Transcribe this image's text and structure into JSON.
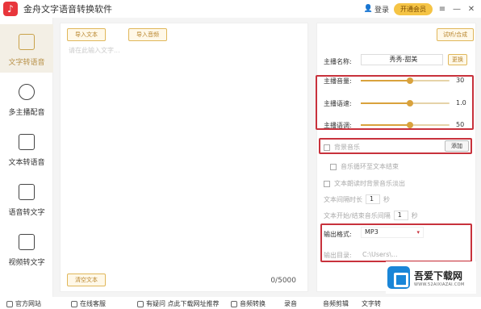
{
  "window": {
    "title": "金舟文字语音转换软件",
    "login": "登录",
    "vip": "开通会员"
  },
  "sidebar": {
    "items": [
      {
        "label": "文字转语音",
        "active": true
      },
      {
        "label": "多主播配音"
      },
      {
        "label": "文本转语音"
      },
      {
        "label": "语音转文字"
      },
      {
        "label": "视频转文字"
      }
    ]
  },
  "main": {
    "btn_import_text": "导入文本",
    "btn_import_audio": "导入音频",
    "placeholder": "请在此输入文字...",
    "btn_clear": "清空文本",
    "counter": "0/5000"
  },
  "right": {
    "btn_top": "试听/合成",
    "anchor_label": "主播名称:",
    "anchor_value": "秀秀-甜美",
    "anchor_btn": "更换",
    "volume_label": "主播音量:",
    "volume_value": "30",
    "speed_label": "主播语速:",
    "speed_value": "1.0",
    "pitch_label": "主播语调:",
    "pitch_value": "50",
    "bgm_label": "背景音乐",
    "bgm_btn": "添加",
    "opt1": "音乐循环至文本结束",
    "opt2": "文本朗读时背景音乐淡出",
    "opt3_label": "文本间隔时长",
    "opt3_value": "1",
    "opt3_unit": "秒",
    "opt4_label": "文本开始/结束音乐间隔",
    "opt4_value": "1",
    "opt4_unit": "秒",
    "format_label": "输出格式:",
    "format_value": "MP3",
    "dir_label": "输出目录:",
    "dir_value": "C:\\Users\\...",
    "volume_level": 0.55,
    "speed_level": 0.55,
    "pitch_level": 0.55
  },
  "bottom": {
    "item1": "官方网站",
    "item2": "在线客服",
    "item3": "有疑问 点此下载网址推荐",
    "item4": "音频转换",
    "item5": "录音",
    "item6": "音频剪辑",
    "item7": "文字转"
  },
  "watermark": {
    "title": "吾爱下载网",
    "url": "WWW.52AIXIAZAI.COM",
    "brand_color": "#1a86d8"
  }
}
